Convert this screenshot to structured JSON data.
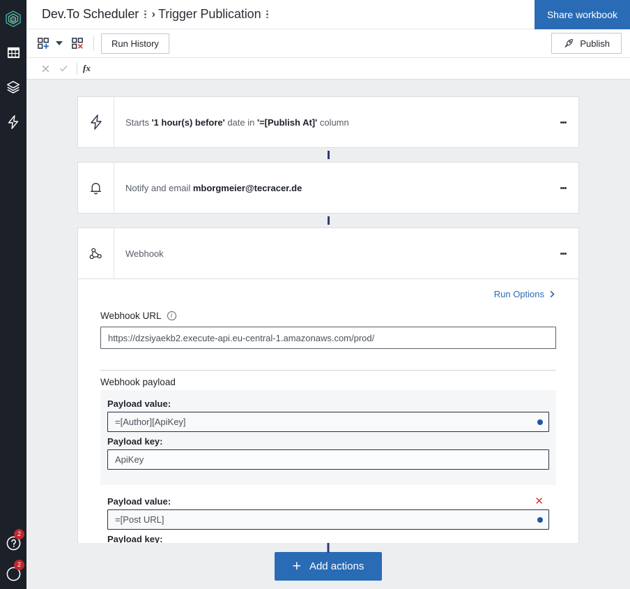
{
  "rail": {
    "logo": "hexagon-logo",
    "items": [
      {
        "icon": "grid-table-icon",
        "name": "tables"
      },
      {
        "icon": "layers-icon",
        "name": "layers"
      },
      {
        "icon": "lightning-bolt-icon",
        "name": "automations"
      }
    ],
    "bottom": [
      {
        "icon": "help-question-icon",
        "name": "help",
        "badge": "2"
      },
      {
        "icon": "notification-icon",
        "name": "notifications",
        "badge": "2"
      }
    ]
  },
  "header": {
    "workbook_title": "Dev.To Scheduler",
    "separator": "›",
    "page_title": "Trigger Publication",
    "share_label": "Share workbook"
  },
  "toolbar": {
    "add_block_icon": "add-block-icon",
    "delete_block_icon": "delete-block-icon",
    "run_history_label": "Run History",
    "publish_label": "Publish",
    "publish_icon": "rocket-icon"
  },
  "formula_bar": {
    "cancel_icon": "close-icon",
    "confirm_icon": "check-icon",
    "fx_label": "fx"
  },
  "flow": {
    "cards": [
      {
        "icon": "lightning-bolt-icon",
        "name": "trigger-card",
        "segments": [
          {
            "text": "Starts ",
            "bold": false
          },
          {
            "text": "'1 hour(s) before'",
            "bold": true
          },
          {
            "text": " date in ",
            "bold": false
          },
          {
            "text": "'=[Publish At]'",
            "bold": true
          },
          {
            "text": " column",
            "bold": false
          }
        ]
      },
      {
        "icon": "bell-icon",
        "name": "notify-card",
        "segments": [
          {
            "text": "Notify and email ",
            "bold": false
          },
          {
            "text": "mborgmeier@tecracer.de",
            "bold": true
          }
        ]
      },
      {
        "icon": "webhook-icon",
        "name": "webhook-card",
        "segments": [
          {
            "text": "Webhook",
            "bold": false
          }
        ]
      }
    ]
  },
  "webhook_panel": {
    "run_options_label": "Run Options",
    "url_label": "Webhook URL",
    "url_value": "https://dzsiyaekb2.execute-api.eu-central-1.amazonaws.com/prod/",
    "payload_section_title": "Webhook payload",
    "entries": [
      {
        "value_label": "Payload value:",
        "value": "=[Author][ApiKey]",
        "key_label": "Payload key:",
        "key": "ApiKey",
        "removable": false
      },
      {
        "value_label": "Payload value:",
        "value": "=[Post URL]",
        "key_label": "Payload key:",
        "key": "",
        "removable": true,
        "remove_label": "✕"
      }
    ]
  },
  "footer": {
    "add_actions_label": "Add actions",
    "plus": "+"
  },
  "colors": {
    "accent_blue": "#2a6bb5",
    "rail_bg": "#1b2029",
    "canvas_bg": "#eceef0",
    "badge_red": "#c0272d",
    "remove_red": "#d9382c",
    "connector": "#31397a"
  }
}
